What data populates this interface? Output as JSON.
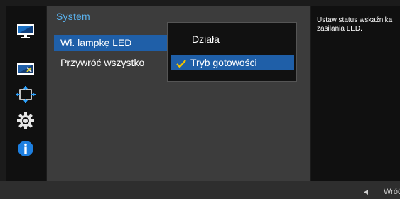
{
  "sidebar": {
    "icons": [
      "picture-icon",
      "color-icon",
      "size-position-icon",
      "setup-icon",
      "info-icon"
    ]
  },
  "panel": {
    "title": "System",
    "items": [
      {
        "label": "Wł. lampkę LED",
        "selected": true
      },
      {
        "label": "Przywróć wszystko",
        "selected": false
      }
    ]
  },
  "submenu": {
    "options": [
      {
        "label": "Działa",
        "selected": false
      },
      {
        "label": "Tryb gotowości",
        "selected": true
      }
    ]
  },
  "help": {
    "text": "Ustaw status wskaźnika zasilania LED."
  },
  "footer": {
    "back_label": "Wróć"
  },
  "colors": {
    "accent": "#1f5fa8",
    "title": "#5ab2ee",
    "panel_bg": "#3c3c3c",
    "check": "#f5c400"
  }
}
